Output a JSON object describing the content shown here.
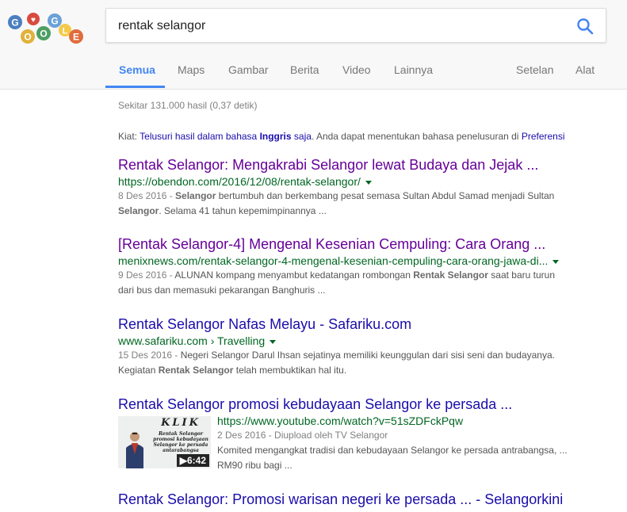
{
  "search": {
    "query": "rentak selangor"
  },
  "tabs": [
    {
      "label": "Semua"
    },
    {
      "label": "Maps"
    },
    {
      "label": "Gambar"
    },
    {
      "label": "Berita"
    },
    {
      "label": "Video"
    },
    {
      "label": "Lainnya"
    }
  ],
  "tools": {
    "settings": "Setelan",
    "tools": "Alat"
  },
  "stats": "Sekitar 131.000 hasil (0,37 detik)",
  "hint": {
    "prefix": "Kiat: ",
    "link1": "Telusuri hasil dalam bahasa ",
    "link1_bold": "Inggris",
    "link1_end": " saja",
    "middle": ". Anda dapat menentukan bahasa penelusuran di ",
    "link2": "Preferensi"
  },
  "results": [
    {
      "title": "Rentak Selangor: Mengakrabi Selangor lewat Budaya dan Jejak ...",
      "url": "https://obendon.com/2016/12/08/rentak-selangor/",
      "date": "8 Des 2016 - ",
      "s1": "Selangor",
      "s2": " bertumbuh dan berkembang pesat semasa Sultan Abdul Samad menjadi Sultan",
      "s3": "Selangor",
      "s4": ". Selama 41 tahun kepemimpinannya ..."
    },
    {
      "title": "[Rentak Selangor-4] Mengenal Kesenian Cempuling: Cara Orang ...",
      "url": "menixnews.com/rentak-selangor-4-mengenal-kesenian-cempuling-cara-orang-jawa-di...",
      "date": "9 Des 2016 - ",
      "s1": "ALUNAN kompang menyambut kedatangan rombongan ",
      "s2": "Rentak Selangor",
      "s3": " saat baru turun",
      "s4": "dari bus dan memasuki pekarangan Banghuris ..."
    },
    {
      "title": "Rentak Selangor Nafas Melayu - Safariku.com",
      "url": "www.safariku.com › Travelling",
      "date": "15 Des 2016 - ",
      "s1": "Negeri Selangor Darul Ihsan sejatinya memiliki keunggulan dari sisi seni dan budayanya.",
      "s2": "Kegiatan ",
      "s3": "Rentak Selangor",
      "s4": " telah membuktikan hal itu."
    },
    {
      "title": "Rentak Selangor promosi kebudayaan Selangor ke persada ...",
      "url": "https://www.youtube.com/watch?v=51sZDFckPqw",
      "date": "2 Des 2016 - Diupload oleh TV Selangor",
      "s1": "Komited mengangkat tradisi dan kebudayaan Selangor ke persada antrabangsa, ...",
      "s2": "RM90 ribu bagi ...",
      "duration": "6:42",
      "thumb_klik": "KLIK",
      "thumb_caption": "Rentak Selangor promosi kebudayaan Selangor ke persada antarabangsa"
    },
    {
      "title": "Rentak Selangor: Promosi warisan negeri ke persada ... - Selangorkini"
    }
  ],
  "colors": {
    "link": "#1a0dab",
    "visited": "#660099",
    "url": "#006621",
    "accent": "#4285f4"
  }
}
